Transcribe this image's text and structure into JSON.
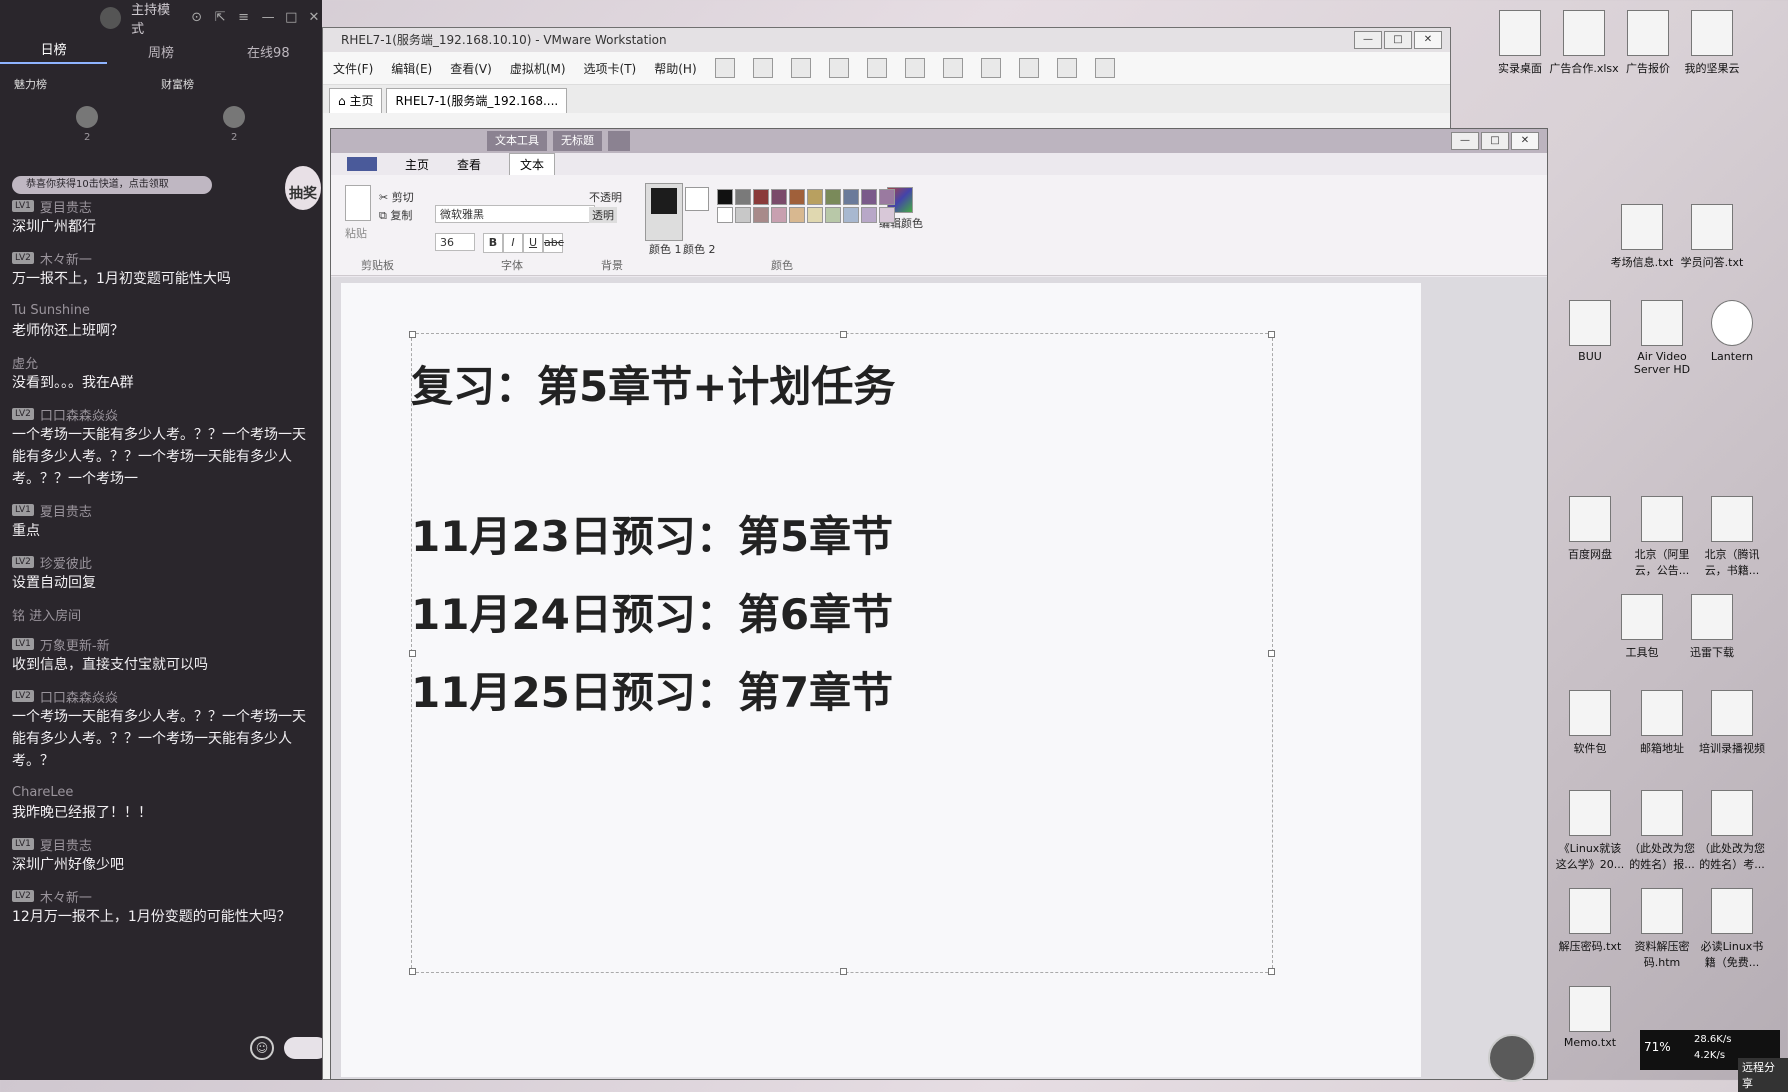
{
  "chat": {
    "top_title": "主持模式",
    "tabs": [
      "日榜",
      "周榜",
      "在线98"
    ],
    "rank_headers": [
      "魅力榜",
      "财富榜"
    ],
    "rank_values": [
      "2",
      "2"
    ],
    "notice": "恭喜你获得10击快道，点击领取",
    "side_button": "抽奖",
    "messages": [
      {
        "level": "LV1",
        "user": "夏目贵志",
        "text": "深圳广州都行"
      },
      {
        "level": "LV2",
        "user": "木々新一",
        "text": "万一报不上，1月初变题可能性大吗"
      },
      {
        "level": "",
        "user": "Tu Sunshine",
        "text": "老师你还上班啊？"
      },
      {
        "level": "",
        "user": "虚允",
        "text": "没看到。。。我在A群"
      },
      {
        "level": "LV2",
        "user": "口口森森焱焱",
        "text": "一个考场一天能有多少人考。？？一个考场一天能有多少人考。？？一个考场一天能有多少人考。？？一个考场一"
      },
      {
        "level": "LV1",
        "user": "夏目贵志",
        "text": "重点"
      },
      {
        "level": "LV2",
        "user": "珍爱彼此",
        "text": "设置自动回复"
      },
      {
        "level": "",
        "user": "铭 进入房间",
        "text": ""
      },
      {
        "level": "LV1",
        "user": "万象更新-新",
        "text": "收到信息，直接支付宝就可以吗"
      },
      {
        "level": "LV2",
        "user": "口口森森焱焱",
        "text": "一个考场一天能有多少人考。？？一个考场一天能有多少人考。？？一个考场一天能有多少人考。？"
      },
      {
        "level": "",
        "user": "ChareLee",
        "text": "我昨晚已经报了！！！"
      },
      {
        "level": "LV1",
        "user": "夏目贵志",
        "text": "深圳广州好像少吧"
      },
      {
        "level": "LV2",
        "user": "木々新一",
        "text": "12月万一报不上，1月份变题的可能性大吗？"
      }
    ]
  },
  "vmware": {
    "title": "RHEL7-1(服务端_192.168.10.10) - VMware Workstation",
    "menus": [
      "文件(F)",
      "编辑(E)",
      "查看(V)",
      "虚拟机(M)",
      "选项卡(T)",
      "帮助(H)"
    ],
    "tabs": [
      "主页",
      "RHEL7-1(服务端_192.168...."
    ]
  },
  "paint": {
    "context_tabs": [
      "文本工具",
      "无标题"
    ],
    "ribbon_tabs": [
      "主页",
      "查看",
      "文本"
    ],
    "clipboard": {
      "cut": "剪切",
      "copy": "复制",
      "paste": "粘贴",
      "label": "剪贴板"
    },
    "font": {
      "name": "微软雅黑",
      "size": "36",
      "label": "字体"
    },
    "background": {
      "opaque": "不透明",
      "transparent": "透明",
      "label": "背景"
    },
    "colors": {
      "color1": "颜色 1",
      "color2": "颜色 2",
      "edit": "编辑颜色",
      "label": "颜色"
    },
    "document": {
      "title": "复习：第5章节+计划任务",
      "lines": [
        "11月23日预习：第5章节",
        "11月24日预习：第6章节",
        "11月25日预习：第7章节"
      ]
    }
  },
  "desktop": {
    "icons": [
      {
        "label": "考场信息.txt"
      },
      {
        "label": "学员问答.txt"
      },
      {
        "label": "BUU"
      },
      {
        "label": "Air Video Server HD"
      },
      {
        "label": "Lantern"
      },
      {
        "label": "百度网盘"
      },
      {
        "label": "北京（阿里云，公告..."
      },
      {
        "label": "北京（腾讯云，书籍..."
      },
      {
        "label": "工具包"
      },
      {
        "label": "迅雷下载"
      },
      {
        "label": "软件包"
      },
      {
        "label": "邮箱地址"
      },
      {
        "label": "培训录播视频"
      },
      {
        "label": "《Linux就该这么学》20..."
      },
      {
        "label": "（此处改为您的姓名）报..."
      },
      {
        "label": "（此处改为您的姓名）考..."
      },
      {
        "label": "解压密码.txt"
      },
      {
        "label": "资料解压密码.htm"
      },
      {
        "label": "必读Linux书籍（免费..."
      },
      {
        "label": "Memo.txt"
      }
    ],
    "top_icons": [
      "实录桌面",
      "广告合作.xlsx",
      "广告报价",
      "我的坚果云"
    ]
  },
  "tray": {
    "cpu": "71%",
    "up": "28.6K/s",
    "down": "4.2K/s",
    "share": "远程分享"
  }
}
